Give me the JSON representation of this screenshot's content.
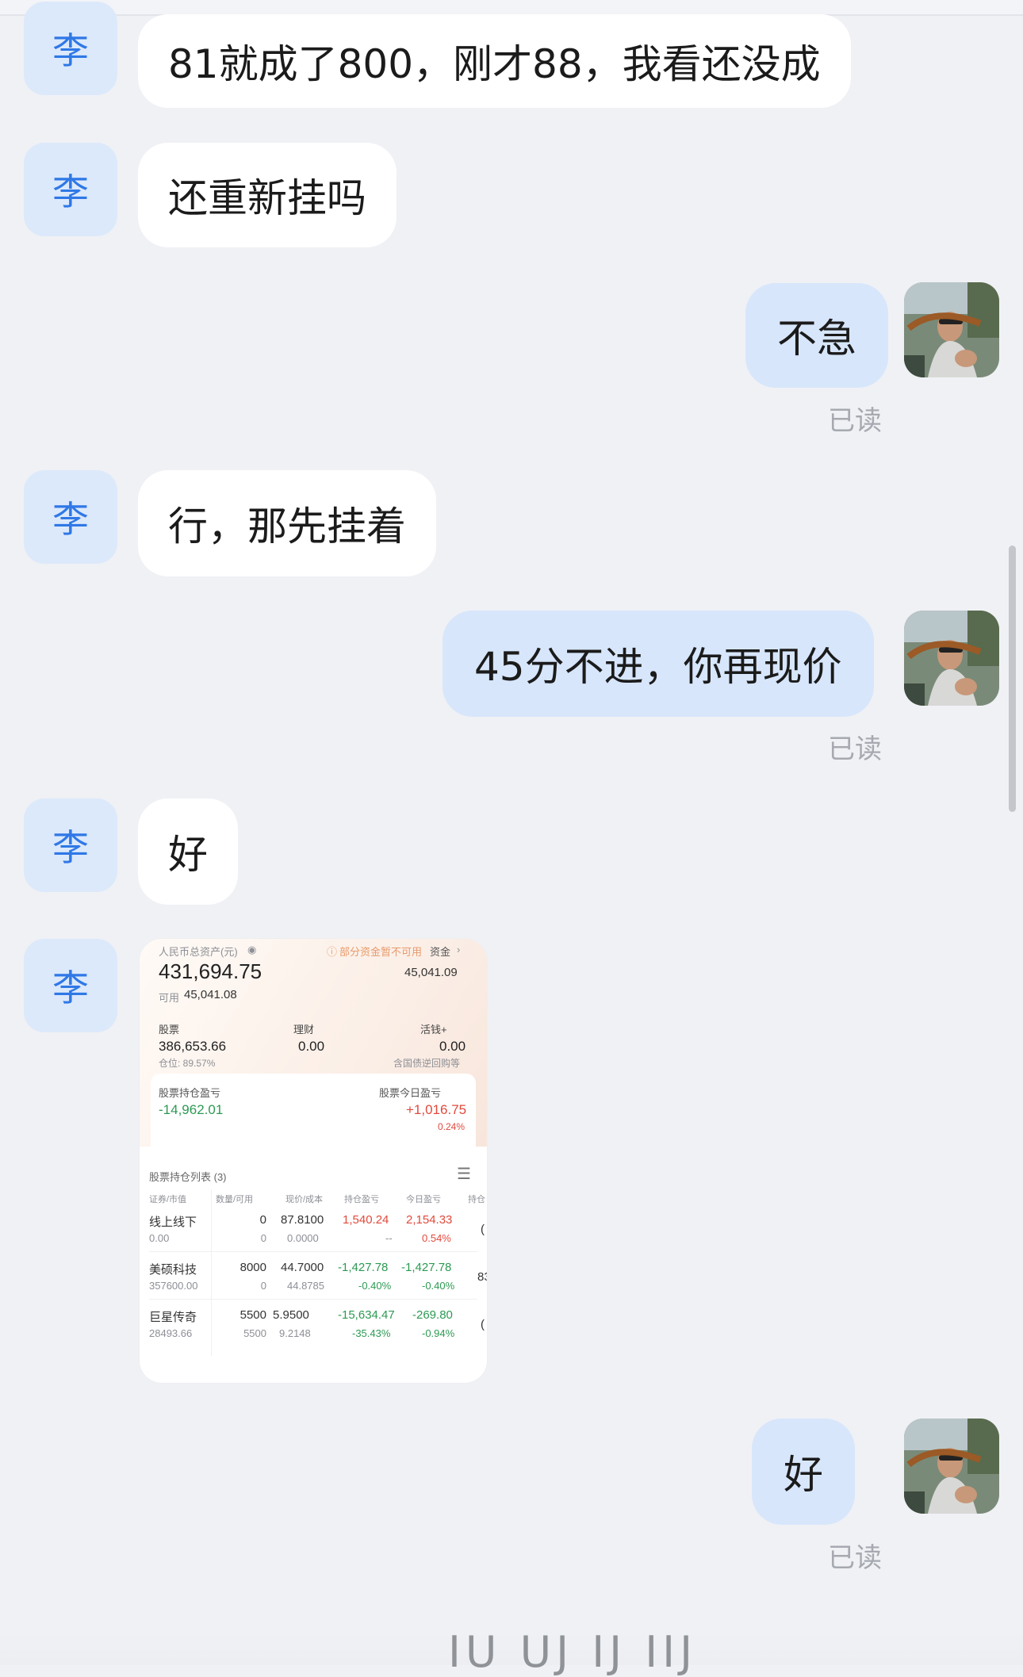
{
  "contact_avatar_label": "李",
  "messages": [
    {
      "id": "m1",
      "side": "in",
      "text": "81就成了800，刚才88，我看还没成"
    },
    {
      "id": "m2",
      "side": "in",
      "text": "还重新挂吗"
    },
    {
      "id": "m3",
      "side": "out",
      "text": "不急",
      "status": "已读"
    },
    {
      "id": "m4",
      "side": "in",
      "text": "行，那先挂着"
    },
    {
      "id": "m5",
      "side": "out",
      "text": "45分不进，你再现价",
      "status": "已读"
    },
    {
      "id": "m6",
      "side": "in",
      "text": "好"
    },
    {
      "id": "m7",
      "side": "in",
      "type": "image"
    },
    {
      "id": "m8",
      "side": "out",
      "text": "好",
      "status": "已读"
    }
  ],
  "screenshot": {
    "total_assets_label": "人民币总资产(元)",
    "partial_notice": "部分资金暂不可用",
    "funds_label": "资金",
    "total_assets": "431,694.75",
    "funds_value": "45,041.09",
    "available_label": "可用",
    "available_value": "45,041.08",
    "stocks_label": "股票",
    "stocks_value": "386,653.66",
    "position_ratio_label": "仓位: 89.57%",
    "wealth_label": "理财",
    "wealth_value": "0.00",
    "huoqian_label": "活钱+",
    "huoqian_value": "0.00",
    "huoqian_note": "含国债逆回购等",
    "holding_pl_label": "股票持仓盈亏",
    "holding_pl_value": "-14,962.01",
    "today_pl_label": "股票今日盈亏",
    "today_pl_value": "+1,016.75",
    "today_pl_pct": "0.24%",
    "list_title": "股票持仓列表 (3)",
    "columns": [
      "证券/市值",
      "数量/可用",
      "现价/成本",
      "持仓盈亏",
      "今日盈亏",
      "持仓"
    ],
    "rows": [
      {
        "name": "线上线下",
        "mv": "0.00",
        "qty": "0",
        "avail": "0",
        "price": "87.8100",
        "cost": "0.0000",
        "pl": "1,540.24",
        "pl_pct": "--",
        "today": "2,154.33",
        "today_pct": "0.54%"
      },
      {
        "name": "美硕科技",
        "mv": "357600.00",
        "qty": "8000",
        "avail": "0",
        "price": "44.7000",
        "cost": "44.8785",
        "pl": "-1,427.78",
        "pl_pct": "-0.40%",
        "today": "-1,427.78",
        "today_pct": "-0.40%"
      },
      {
        "name": "巨星传奇",
        "mv": "28493.66",
        "qty": "5500",
        "avail": "5500",
        "price": "5.9500",
        "cost": "9.2148",
        "pl": "-15,634.47",
        "pl_pct": "-35.43%",
        "today": "-269.80",
        "today_pct": "-0.94%"
      }
    ],
    "row_cut_chars": [
      "(",
      "83",
      "("
    ]
  },
  "watermark": "IU UJ IJ IIJ"
}
